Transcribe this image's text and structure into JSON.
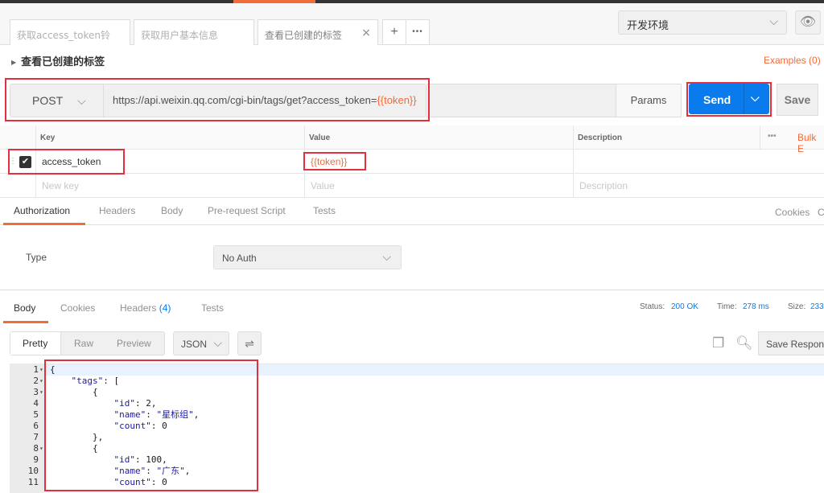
{
  "tabs": [
    {
      "label": "获取access_token铃"
    },
    {
      "label": "获取用户基本信息"
    },
    {
      "label": "查看已创建的标签",
      "active": true
    }
  ],
  "tab_add": "+",
  "tab_more": "•••",
  "env": {
    "selected": "开发环境"
  },
  "request": {
    "title": "查看已创建的标签",
    "examples": "Examples (0)",
    "method": "POST",
    "url_base": "https://api.weixin.qq.com/cgi-bin/tags/get?access_token=",
    "url_var": "{{token}}",
    "params": "Params",
    "send": "Send",
    "save": "Save"
  },
  "params_table": {
    "headers": {
      "key": "Key",
      "value": "Value",
      "description": "Description",
      "bulk": "Bulk E"
    },
    "rows": [
      {
        "key": "access_token",
        "value": "{{token}}",
        "description": "",
        "checked": true
      }
    ],
    "new_row": {
      "key": "New key",
      "value": "Value",
      "description": "Description"
    }
  },
  "req_tabs": [
    "Authorization",
    "Headers",
    "Body",
    "Pre-request Script",
    "Tests"
  ],
  "req_links": {
    "cookies": "Cookies",
    "code": "C"
  },
  "auth": {
    "type_label": "Type",
    "type_value": "No Auth"
  },
  "resp_tabs": {
    "body": "Body",
    "cookies": "Cookies",
    "headers": "Headers",
    "headers_count": "(4)",
    "tests": "Tests"
  },
  "resp_status": {
    "status_label": "Status:",
    "status_value": "200 OK",
    "time_label": "Time:",
    "time_value": "278 ms",
    "size_label": "Size:",
    "size_value": "233"
  },
  "view_modes": {
    "pretty": "Pretty",
    "raw": "Raw",
    "preview": "Preview",
    "format": "JSON",
    "save_response": "Save Respon"
  },
  "response_lines": [
    {
      "n": "1",
      "fold": true,
      "text": "{"
    },
    {
      "n": "2",
      "fold": true,
      "text": "    \"tags\": ["
    },
    {
      "n": "3",
      "fold": true,
      "text": "        {"
    },
    {
      "n": "4",
      "fold": false,
      "text": "            \"id\": 2,"
    },
    {
      "n": "5",
      "fold": false,
      "text": "            \"name\": \"星标组\","
    },
    {
      "n": "6",
      "fold": false,
      "text": "            \"count\": 0"
    },
    {
      "n": "7",
      "fold": false,
      "text": "        },"
    },
    {
      "n": "8",
      "fold": true,
      "text": "        {"
    },
    {
      "n": "9",
      "fold": false,
      "text": "            \"id\": 100,"
    },
    {
      "n": "10",
      "fold": false,
      "text": "            \"name\": \"广东\","
    },
    {
      "n": "11",
      "fold": false,
      "text": "            \"count\": 0"
    }
  ]
}
